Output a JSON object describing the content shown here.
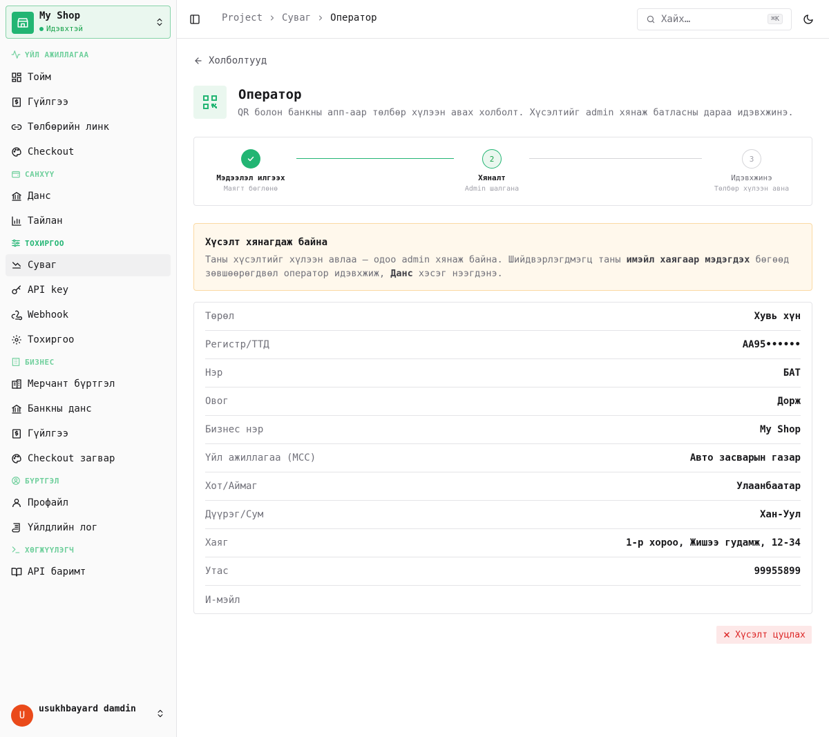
{
  "sidebar": {
    "shop": {
      "name": "My Shop",
      "status": "Идэвхтэй"
    },
    "sections": [
      {
        "label": "ҮЙЛ АЖИЛЛАГАА"
      },
      {
        "label": "САНХҮҮ"
      },
      {
        "label": "ТОХИРГОО"
      },
      {
        "label": "БИЗНЕС"
      },
      {
        "label": "БҮРТГЭЛ"
      },
      {
        "label": "ХӨГЖҮҮЛЭГЧ"
      }
    ],
    "items": [
      {
        "label": "Тойм"
      },
      {
        "label": "Гүйлгээ"
      },
      {
        "label": "Төлбөрийн линк"
      },
      {
        "label": "Checkout"
      },
      {
        "label": "Данс"
      },
      {
        "label": "Тайлан"
      },
      {
        "label": "Суваг"
      },
      {
        "label": "API key"
      },
      {
        "label": "Webhook"
      },
      {
        "label": "Тохиргоо"
      },
      {
        "label": "Мерчант бүртгэл"
      },
      {
        "label": "Банкны данс"
      },
      {
        "label": "Гүйлгээ"
      },
      {
        "label": "Checkout загвар"
      },
      {
        "label": "Профайл"
      },
      {
        "label": "Үйлдлийн лог"
      },
      {
        "label": "API баримт"
      }
    ],
    "user": {
      "initial": "U",
      "name": "usukhbayard damdin"
    }
  },
  "header": {
    "breadcrumb": [
      "Project",
      "Суваг",
      "Оператор"
    ],
    "search": {
      "placeholder": "Хайх…",
      "shortcut": "⌘K"
    }
  },
  "main": {
    "back_label": "Холболтууд",
    "title": "Оператор",
    "subtitle": "QR болон банкны апп-аар төлбөр хүлээн авах холболт. Хүсэлтийг admin хянаж батласны дараа идэвхжинэ.",
    "steps": [
      {
        "number": "1",
        "label": "Мэдээлэл илгээх",
        "sub": "Маягт бөглөнө",
        "state": "done"
      },
      {
        "number": "2",
        "label": "Хяналт",
        "sub": "Admin шалгана",
        "state": "current"
      },
      {
        "number": "3",
        "label": "Идэвхжинэ",
        "sub": "Төлбөр хүлээн авна",
        "state": "pending"
      }
    ],
    "alert": {
      "title": "Хүсэлт хянагдаж байна",
      "text_1": "Таны хүсэлтийг хүлээн авлаа — одоо admin хянаж байна. Шийдвэрлэгдмэгц таны ",
      "bold_1": "имэйл хаягаар мэдэгдэх",
      "text_2": " бөгөөд зөвшөөрөгдвөл оператор идэвхжиж, ",
      "bold_2": "Данс",
      "text_3": " хэсэг нээгдэнэ."
    },
    "details": [
      {
        "label": "Төрөл",
        "value": "Хувь хүн"
      },
      {
        "label": "Регистр/ТТД",
        "value": "АА95••••••"
      },
      {
        "label": "Нэр",
        "value": "БАТ"
      },
      {
        "label": "Овог",
        "value": "Дорж"
      },
      {
        "label": "Бизнес нэр",
        "value": "My Shop"
      },
      {
        "label": "Үйл ажиллагаа (MCC)",
        "value": "Авто засварын газар"
      },
      {
        "label": "Хот/Аймаг",
        "value": "Улаанбаатар"
      },
      {
        "label": "Дүүрэг/Сум",
        "value": "Хан-Уул"
      },
      {
        "label": "Хаяг",
        "value": "1-р хороо, Жишээ гудамж, 12-34"
      },
      {
        "label": "Утас",
        "value": "99955899"
      },
      {
        "label": "И-мэйл",
        "value": ""
      }
    ],
    "cancel_label": "Хүсэлт цуцлах"
  },
  "colors": {
    "accent": "#22b573",
    "accent_light": "#eaf7ef",
    "warning_bg": "#fff8ec",
    "danger": "#dc2626"
  }
}
